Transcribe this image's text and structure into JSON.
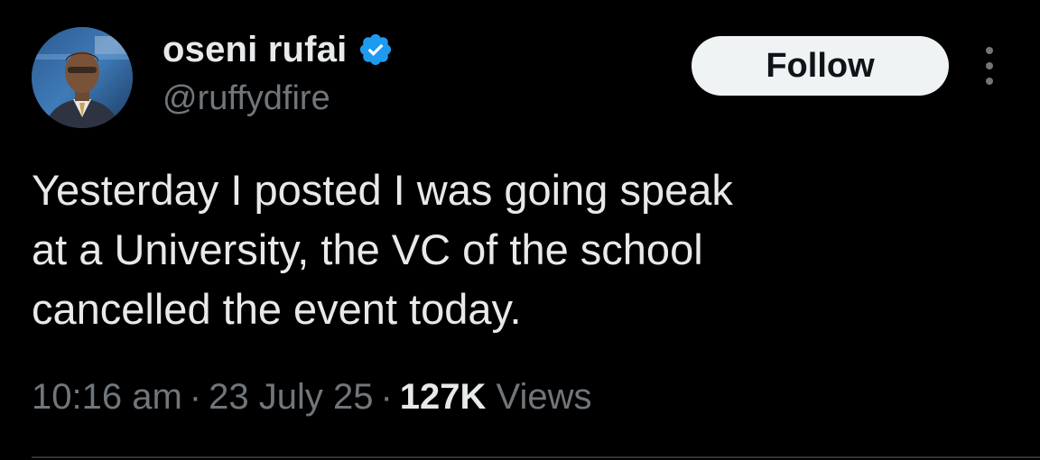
{
  "author": {
    "display_name": "oseni rufai",
    "handle": "@ruffydfire",
    "verified": true,
    "avatar_icon": "avatar-photo"
  },
  "actions": {
    "follow_label": "Follow",
    "more_icon": "more-vertical-icon"
  },
  "tweet": {
    "text_lines": [
      "Yesterday I posted I was going speak",
      "at a University, the VC of the school",
      "cancelled the event today."
    ]
  },
  "meta": {
    "time": "10:16 am",
    "date": "23 July 25",
    "views_count": "127K",
    "views_label": "Views",
    "separator": "·"
  },
  "colors": {
    "background": "#000000",
    "primary_text": "#e7e9ea",
    "secondary_text": "#71767b",
    "verified_badge": "#1d9bf0",
    "follow_button_bg": "#eff3f4"
  }
}
